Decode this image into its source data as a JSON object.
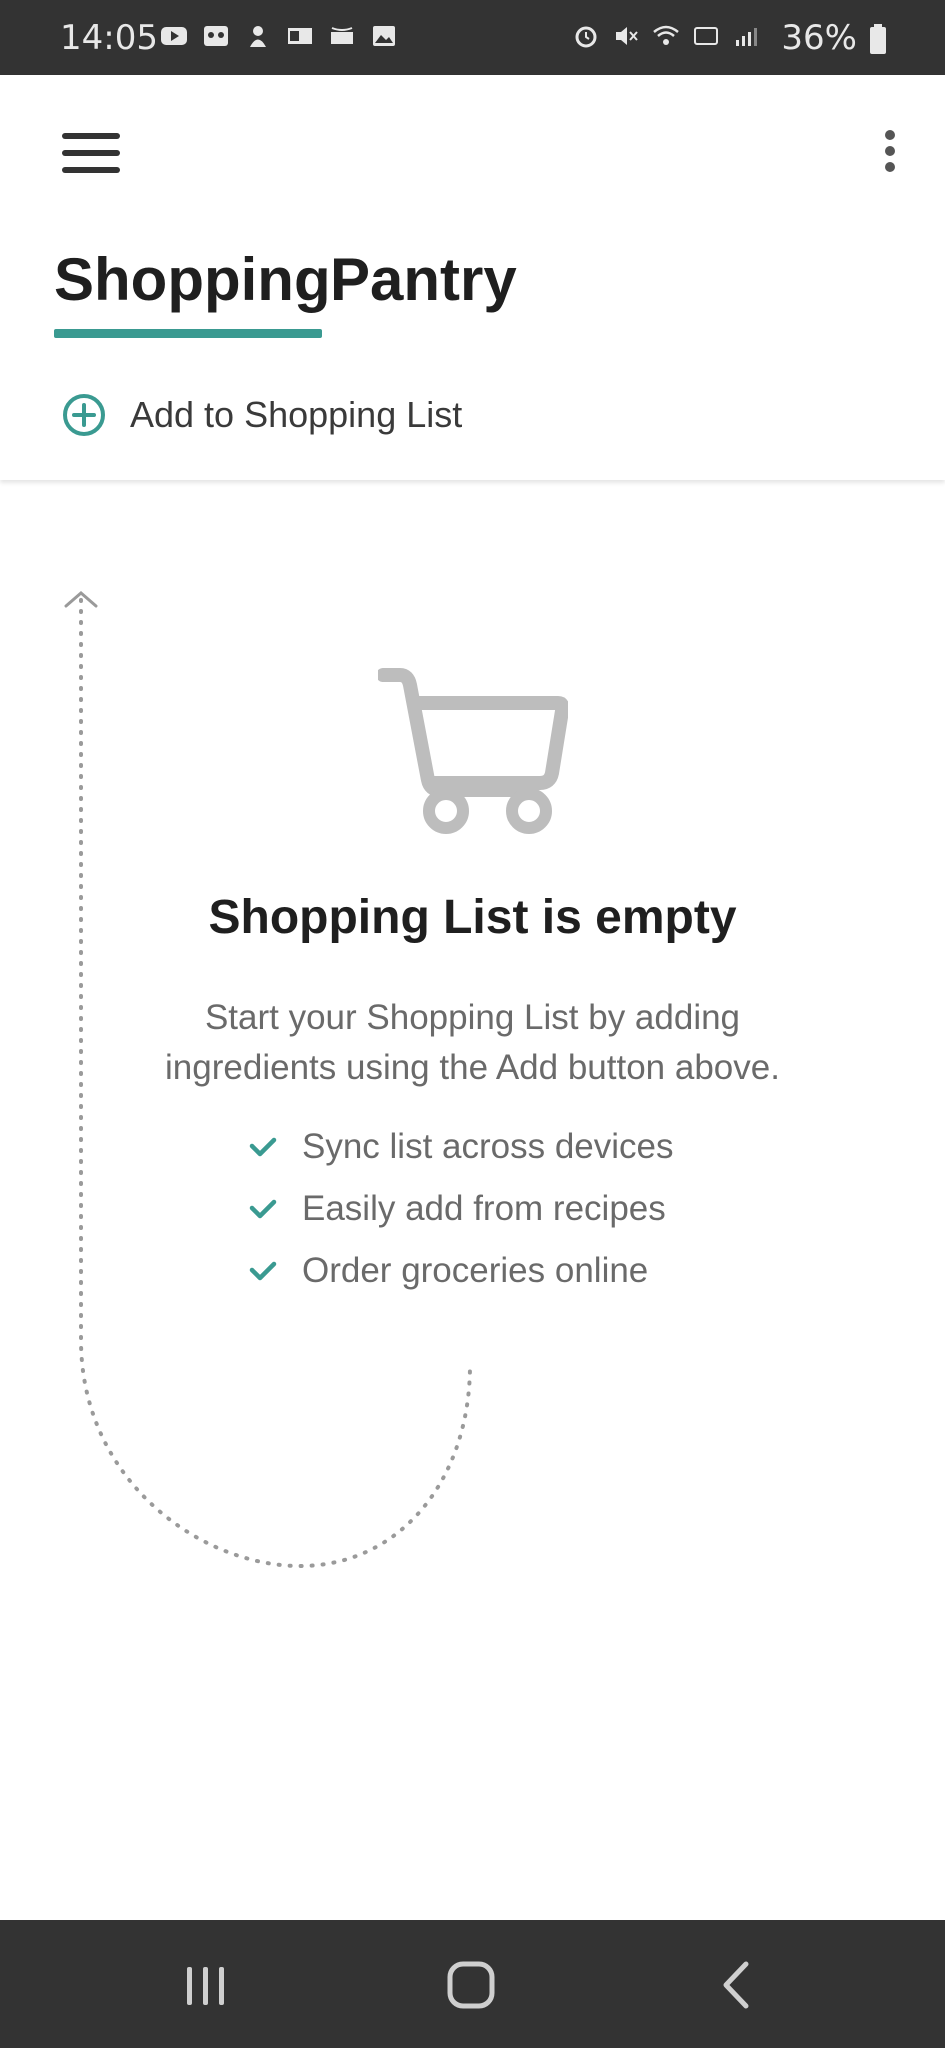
{
  "status_bar": {
    "time": "14:05",
    "battery": "36%",
    "left_icons": [
      "youtube-icon",
      "voicemail-icon",
      "app-icon",
      "outlook-icon",
      "amazon-icon",
      "gallery-icon"
    ],
    "right_icons": [
      "alarm-icon",
      "mute-icon",
      "wifi-icon",
      "volte-icon",
      "signal-icon",
      "battery-icon"
    ]
  },
  "app_bar": {
    "tabs": [
      {
        "label": "Shopping",
        "selected": true
      },
      {
        "label": "Pantry",
        "selected": false
      }
    ],
    "add_label": "Add to Shopping List",
    "accent_color": "#3a9a91"
  },
  "empty_state": {
    "title": "Shopping List is empty",
    "description": "Start your Shopping List by adding ingredients using the Add button above.",
    "features": [
      "Sync list across devices",
      "Easily add from recipes",
      "Order groceries online"
    ]
  },
  "nav_bar": {
    "buttons": [
      "recents-icon",
      "home-icon",
      "back-icon"
    ]
  }
}
